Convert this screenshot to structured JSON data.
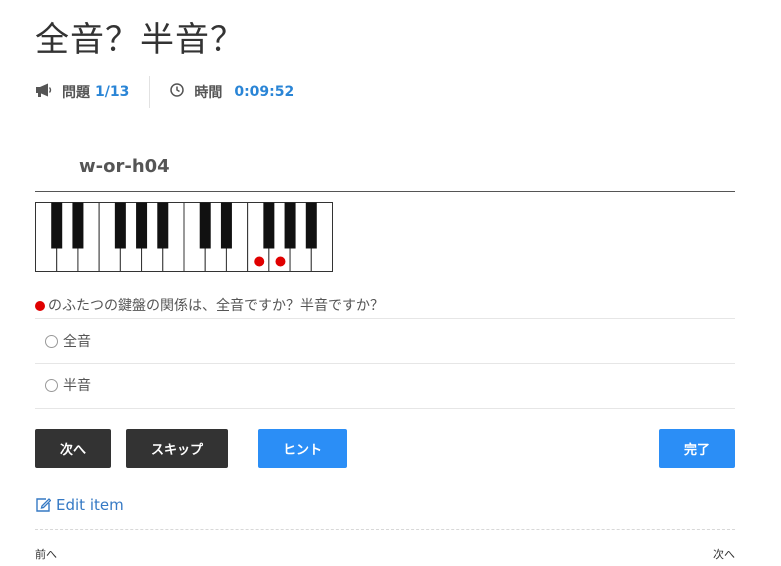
{
  "page": {
    "title": "全音？半音？"
  },
  "meta": {
    "question_label": "問題",
    "question_value": "1/13",
    "time_label": "時間",
    "time_value": "0:09:52"
  },
  "item": {
    "id": "w-or-h04"
  },
  "piano": {
    "white_keys": 14,
    "marked_white_keys": [
      10,
      11
    ],
    "marker_color": "#e00000"
  },
  "question": {
    "text": "のふたつの鍵盤の関係は、全音ですか？半音ですか？"
  },
  "options": [
    {
      "label": "全音"
    },
    {
      "label": "半音"
    }
  ],
  "buttons": {
    "next": "次へ",
    "skip": "スキップ",
    "hint": "ヒント",
    "finish": "完了"
  },
  "edit": {
    "label": "Edit item"
  },
  "pager": {
    "prev": "前へ",
    "next": "次へ"
  }
}
